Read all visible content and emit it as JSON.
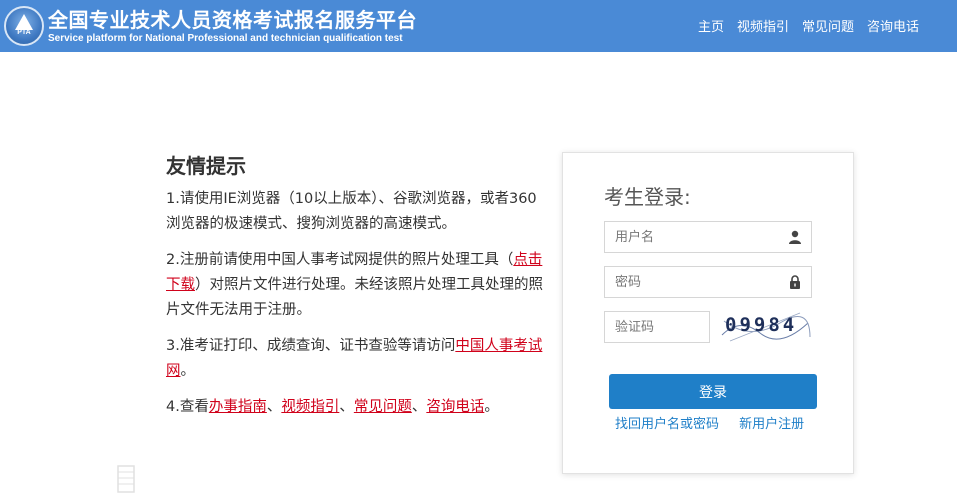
{
  "header": {
    "logo_text": "PTA",
    "title": "全国专业技术人员资格考试报名服务平台",
    "subtitle": "Service platform for National Professional and technician qualification test",
    "nav": [
      {
        "label": "主页"
      },
      {
        "label": "视频指引"
      },
      {
        "label": "常见问题"
      },
      {
        "label": "咨询电话"
      }
    ]
  },
  "tips": {
    "title": "友情提示",
    "item1": "1.请使用IE浏览器（10以上版本）、谷歌浏览器，或者360浏览器的极速模式、搜狗浏览器的高速模式。",
    "item2_prefix": "2.注册前请使用中国人事考试网提供的照片处理工具（",
    "item2_link": "点击下载",
    "item2_suffix": "）对照片文件进行处理。未经该照片处理工具处理的照片文件无法用于注册。",
    "item3_prefix": "3.准考证打印、成绩查询、证书查验等请访问",
    "item3_link": "中国人事考试网",
    "item3_suffix": "。",
    "item4_prefix": "4.查看",
    "item4_links": [
      "办事指南",
      "视频指引",
      "常见问题",
      "咨询电话"
    ],
    "sep": "、",
    "item4_suffix": "。"
  },
  "login": {
    "title": "考生登录:",
    "username_placeholder": "用户名",
    "password_placeholder": "密码",
    "captcha_placeholder": "验证码",
    "captcha_value": "09984",
    "login_button": "登录",
    "forgot_link": "找回用户名或密码",
    "register_link": "新用户注册"
  },
  "colors": {
    "header_bg": "#4a8ad6",
    "link_red": "#d0021b",
    "button_blue": "#1f7fc8"
  }
}
